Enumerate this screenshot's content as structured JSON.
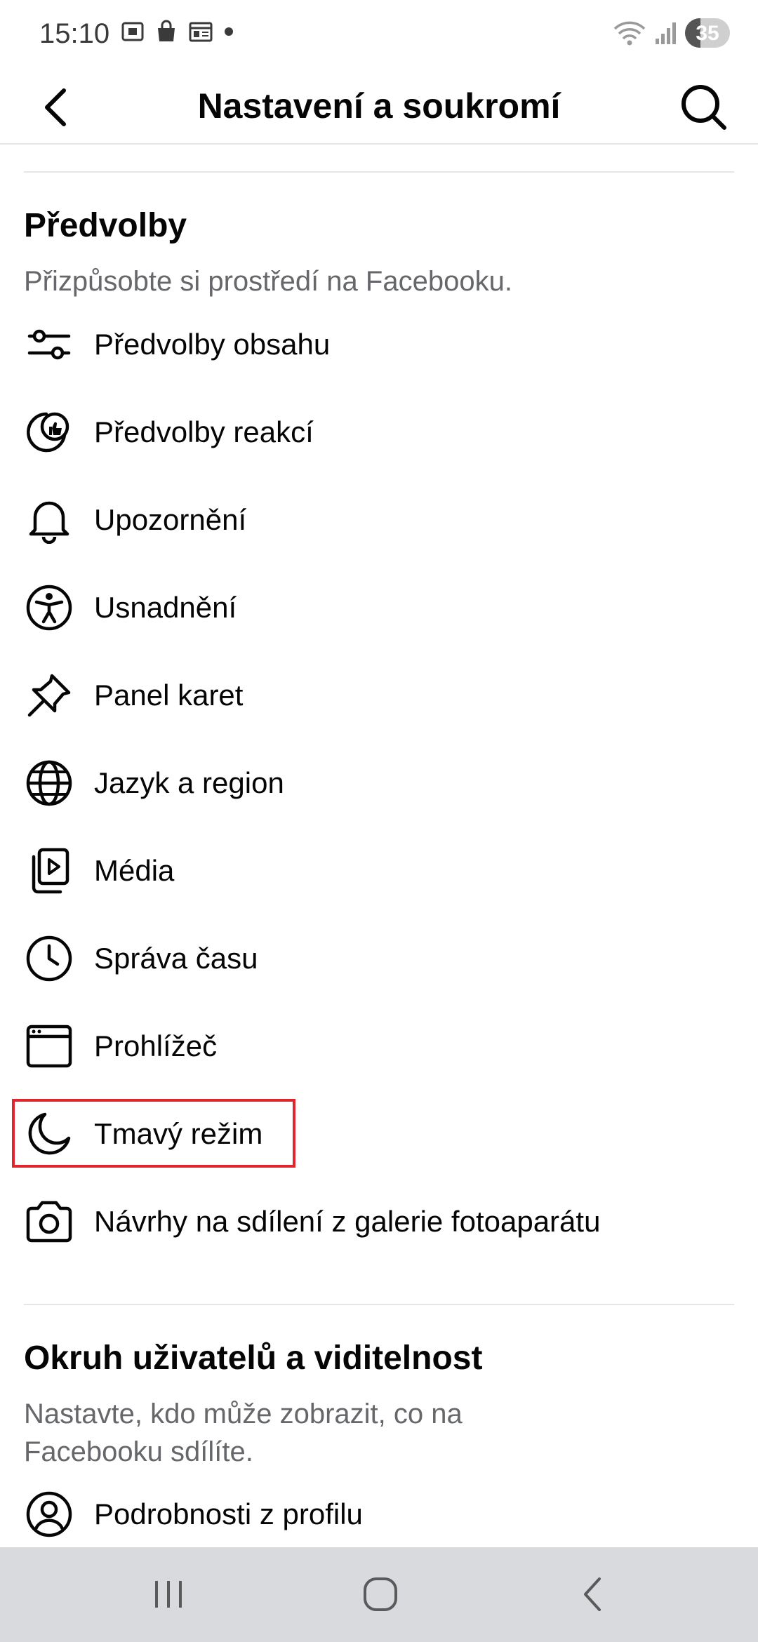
{
  "status_bar": {
    "time": "15:10",
    "battery": "35",
    "battery_level_percent": 35
  },
  "header": {
    "title": "Nastavení a soukromí"
  },
  "preferences": {
    "title": "Předvolby",
    "subtitle": "Přizpůsobte si prostředí na Facebooku.",
    "items": [
      {
        "label": "Předvolby obsahu",
        "icon": "sliders-icon"
      },
      {
        "label": "Předvolby reakcí",
        "icon": "reaction-icon"
      },
      {
        "label": "Upozornění",
        "icon": "bell-icon"
      },
      {
        "label": "Usnadnění",
        "icon": "accessibility-icon"
      },
      {
        "label": "Panel karet",
        "icon": "pin-icon"
      },
      {
        "label": "Jazyk a region",
        "icon": "globe-icon"
      },
      {
        "label": "Média",
        "icon": "media-icon"
      },
      {
        "label": "Správa času",
        "icon": "clock-icon"
      },
      {
        "label": "Prohlížeč",
        "icon": "browser-icon"
      },
      {
        "label": "Tmavý režim",
        "icon": "moon-icon",
        "highlighted": true
      },
      {
        "label": "Návrhy na sdílení z galerie fotoaparátu",
        "icon": "camera-icon"
      }
    ]
  },
  "audience": {
    "title": "Okruh uživatelů a viditelnost",
    "subtitle": "Nastavte, kdo může zobrazit, co na Facebooku sdílíte.",
    "items": [
      {
        "label": "Podrobnosti z profilu",
        "icon": "profile-icon"
      }
    ]
  },
  "colors": {
    "highlight_border": "#e0262c",
    "nav_bar_bg": "#d9dadd",
    "subtitle_text": "#65676b"
  }
}
